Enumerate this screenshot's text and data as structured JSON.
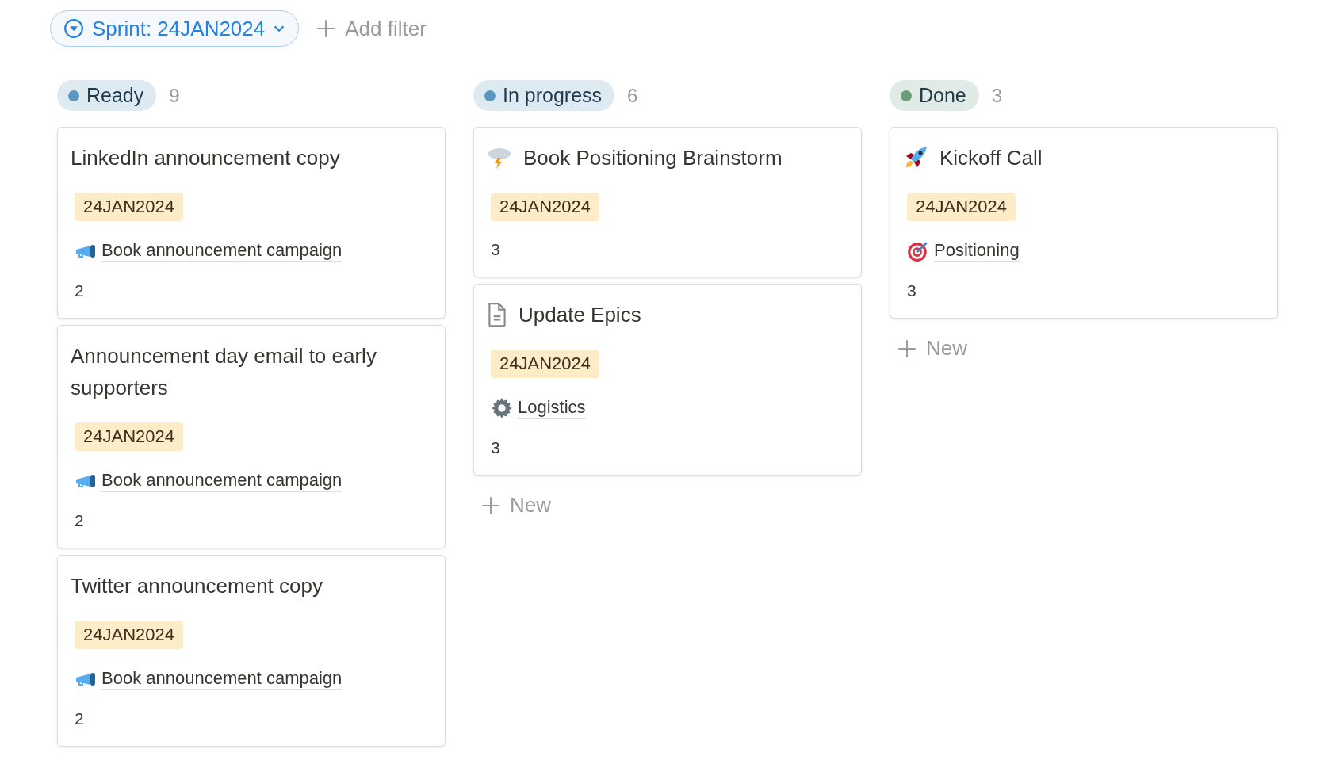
{
  "filter": {
    "label": "Sprint: 24JAN2024"
  },
  "add_filter": {
    "label": "Add filter"
  },
  "columns": [
    {
      "name": "Ready",
      "count": "9",
      "color": "#5b97c0",
      "cards": [
        {
          "kind": "plain",
          "title": "LinkedIn announcement copy",
          "tag": "24JAN2024",
          "relation": {
            "kind": "megaphone",
            "text": "Book announcement campaign"
          },
          "points": "2"
        },
        {
          "kind": "plain",
          "title": "Announcement day email to early supporters",
          "tag": "24JAN2024",
          "relation": {
            "kind": "megaphone",
            "text": "Book announcement campaign"
          },
          "points": "2"
        },
        {
          "kind": "plain",
          "title": "Twitter announcement copy",
          "tag": "24JAN2024",
          "relation": {
            "kind": "megaphone",
            "text": "Book announcement campaign"
          },
          "points": "2"
        }
      ]
    },
    {
      "name": "In progress",
      "count": "6",
      "color": "#5b97c0",
      "cards": [
        {
          "kind": "cloud",
          "title": "Book Positioning Brainstorm",
          "tag": "24JAN2024",
          "points": "3"
        },
        {
          "kind": "document",
          "title": "Update Epics",
          "tag": "24JAN2024",
          "relation": {
            "kind": "gear",
            "text": "Logistics"
          },
          "points": "3"
        }
      ],
      "new_label": "New"
    },
    {
      "name": "Done",
      "count": "3",
      "color": "#6b9c7c",
      "cards": [
        {
          "kind": "rocket",
          "title": "Kickoff Call",
          "tag": "24JAN2024",
          "relation": {
            "kind": "target",
            "text": "Positioning"
          },
          "points": "3"
        }
      ],
      "new_label": "New"
    }
  ]
}
